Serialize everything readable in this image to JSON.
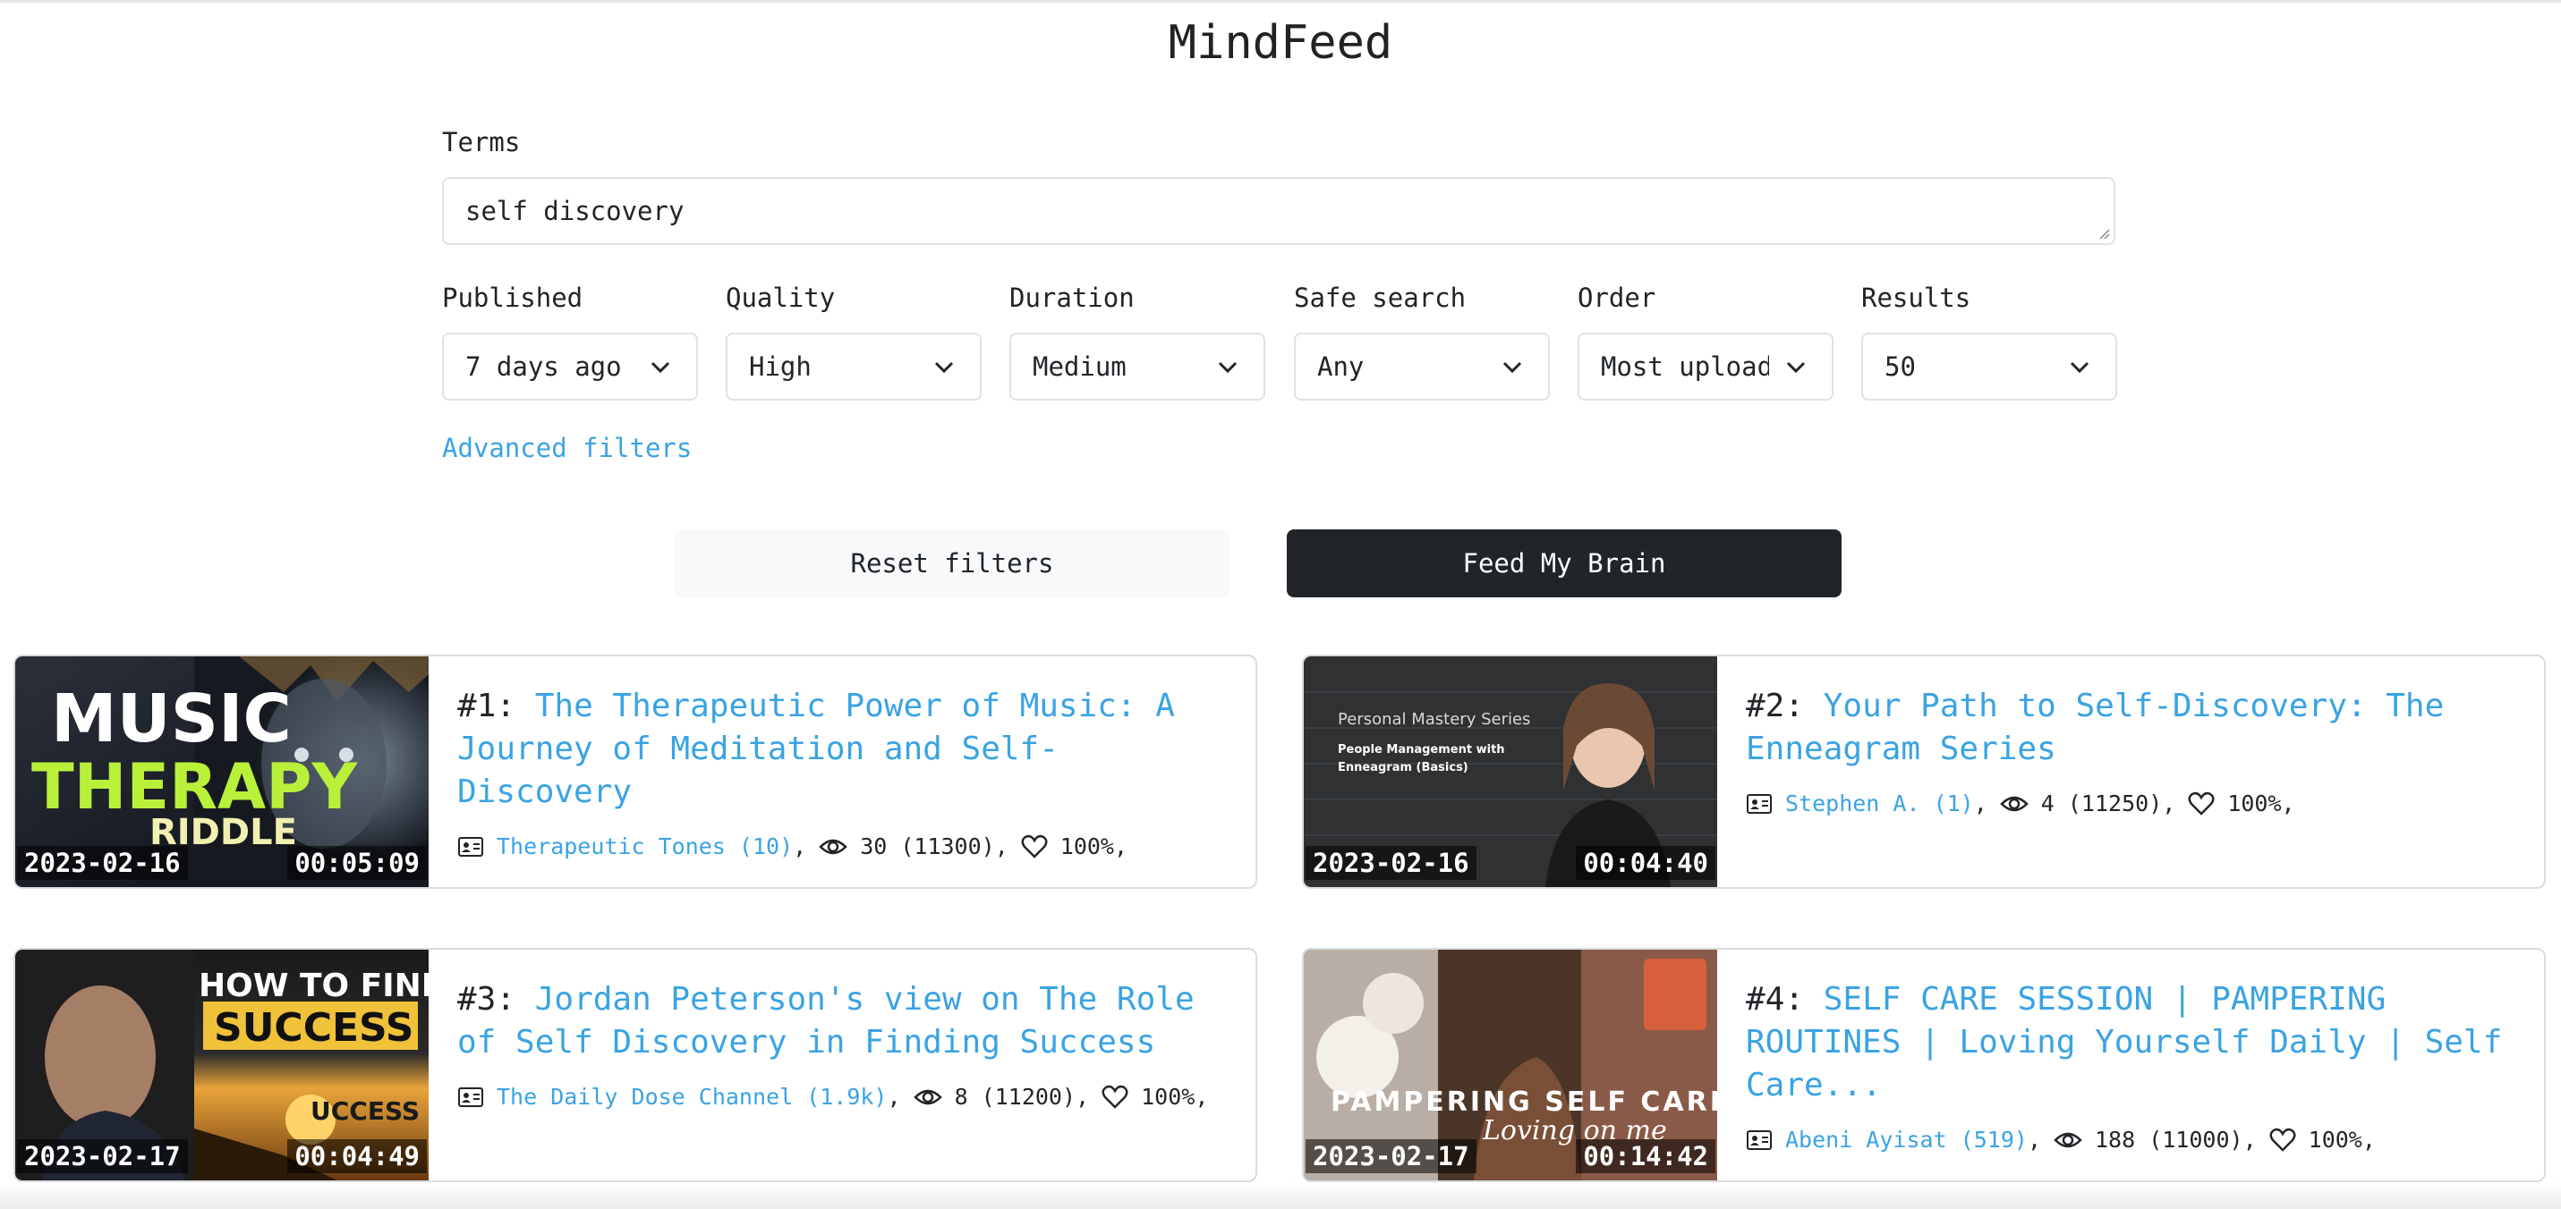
{
  "app": {
    "title": "MindFeed"
  },
  "form": {
    "terms_label": "Terms",
    "terms_value": "self discovery",
    "filters": [
      {
        "label": "Published",
        "value": "7 days ago"
      },
      {
        "label": "Quality",
        "value": "High"
      },
      {
        "label": "Duration",
        "value": "Medium"
      },
      {
        "label": "Safe search",
        "value": "Any"
      },
      {
        "label": "Order",
        "value": "Most uploads"
      },
      {
        "label": "Results",
        "value": "50"
      }
    ],
    "advanced_link": "Advanced filters",
    "reset_button": "Reset filters",
    "submit_button": "Feed My Brain"
  },
  "results": [
    {
      "rank": "#1:",
      "title": "The Therapeutic Power of Music: A Journey of Meditation and Self-Discovery",
      "channel": "Therapeutic Tones (10)",
      "views": "30 (11300)",
      "likes": "100%",
      "date": "2023-02-16",
      "duration": "00:05:09",
      "thumb_text": [
        "MUSIC",
        "THERAPY",
        "RIDDLE"
      ]
    },
    {
      "rank": "#2:",
      "title": "Your Path to Self-Discovery: The Enneagram Series",
      "channel": "Stephen A. (1)",
      "views": "4 (11250)",
      "likes": "100%",
      "date": "2023-02-16",
      "duration": "00:04:40",
      "thumb_text": [
        "Personal Mastery Series",
        "People Management with",
        "Enneagram (Basics)"
      ]
    },
    {
      "rank": "#3:",
      "title": "Jordan Peterson's view on The Role of Self Discovery in Finding Success",
      "channel": "The Daily Dose Channel (1.9k)",
      "views": "8 (11200)",
      "likes": "100%",
      "date": "2023-02-17",
      "duration": "00:04:49",
      "thumb_text": [
        "HOW TO FIND",
        "SUCCESS",
        "UCCESS"
      ]
    },
    {
      "rank": "#4:",
      "title": "SELF CARE SESSION | PAMPERING ROUTINES | Loving Yourself Daily | Self Care...",
      "channel": "Abeni Ayisat (519)",
      "views": "188 (11000)",
      "likes": "100%",
      "date": "2023-02-17",
      "duration": "00:14:42",
      "thumb_text": [
        "PAMPERING SELF CARE",
        "Loving on me"
      ]
    }
  ],
  "colors": {
    "link": "#3aa3e3",
    "dark_button": "#212529",
    "light_button": "#f8f9fa",
    "border": "#dee2e6"
  },
  "icons": {
    "channel": "contact-card-icon",
    "views": "eye-icon",
    "likes": "heart-icon",
    "select": "chevron-down-icon"
  }
}
